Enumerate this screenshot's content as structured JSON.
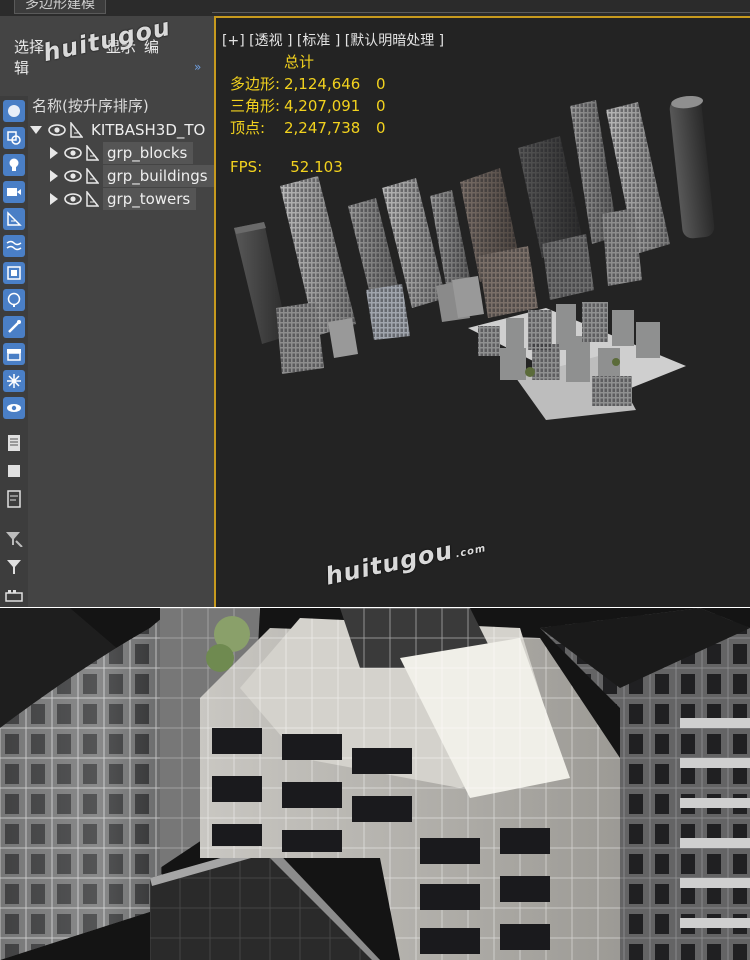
{
  "window": {
    "title": "多边形建模"
  },
  "menu": {
    "select": "选择",
    "display": "显示",
    "edit": "编辑"
  },
  "tree": {
    "header": "名称(按升序排序)",
    "root": "KITBASH3D_TO",
    "children": [
      "grp_blocks",
      "grp_buildings",
      "grp_towers"
    ]
  },
  "viewport": {
    "label": "[+] [透视 ] [标准 ] [默认明暗处理 ]",
    "stats": {
      "total_label": "总计",
      "rows": [
        {
          "key": "多边形:",
          "value": "2,124,646",
          "sel": "0"
        },
        {
          "key": "三角形:",
          "value": "4,207,091",
          "sel": "0"
        },
        {
          "key": "顶点:",
          "value": "2,247,738",
          "sel": "0"
        }
      ],
      "fps_label": "FPS:",
      "fps_value": "52.103"
    }
  },
  "watermark": {
    "text": "huitugou",
    "suffix": ".com"
  },
  "colors": {
    "stats_text": "#f2d21e",
    "active_border": "#c79a1e",
    "tool_blue": "#4a7fc6"
  },
  "icons": [
    "geometry-icon",
    "shapes-icon",
    "light-icon",
    "camera-icon",
    "helper-icon",
    "spacewarp-icon",
    "group-icon",
    "xref-icon",
    "bone-icon",
    "container-icon",
    "frozen-icon",
    "hidden-icon",
    "display-list-icon",
    "display-square-icon",
    "display-details-icon",
    "filter-icon",
    "funnel-icon",
    "layer-manager-icon"
  ]
}
